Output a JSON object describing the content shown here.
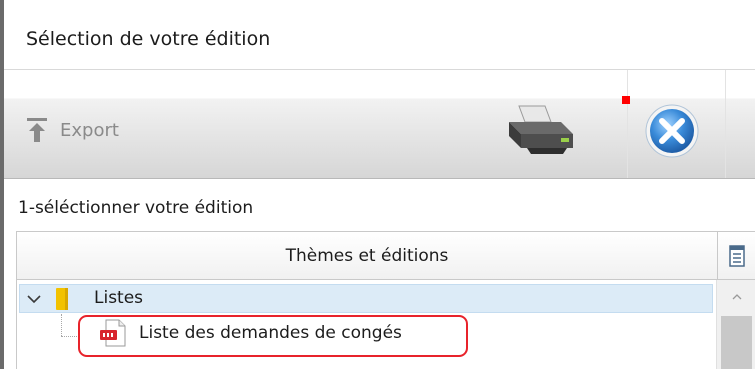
{
  "window": {
    "title": "Sélection de votre édition"
  },
  "toolbar": {
    "export_label": "Export",
    "print_icon": "printer-icon",
    "close_icon": "close-icon"
  },
  "section": {
    "label": "1-séléctionner votre édition"
  },
  "grid": {
    "header": "Thèmes et éditions",
    "tree": [
      {
        "label": "Listes",
        "icon": "folder-icon",
        "expanded": true,
        "children": [
          {
            "label": "Liste des demandes de congés",
            "icon": "pdf-icon",
            "highlighted": true
          }
        ]
      }
    ]
  },
  "colors": {
    "selection_bg": "#dcebf7",
    "highlight_border": "#e8232b",
    "folder_yellow": "#f2c200",
    "close_blue": "#3a8bd9"
  }
}
